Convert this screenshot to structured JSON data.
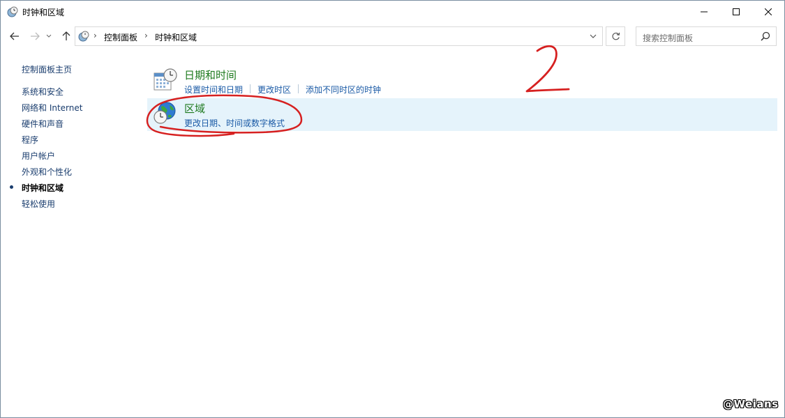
{
  "window": {
    "title": "时钟和区域"
  },
  "nav": {
    "back_icon": "arrow-left-icon",
    "forward_icon": "arrow-right-icon",
    "recent_icon": "chevron-down-icon",
    "up_icon": "arrow-up-icon"
  },
  "address": {
    "crumbs": [
      "控制面板",
      "时钟和区域"
    ]
  },
  "search": {
    "placeholder": "搜索控制面板"
  },
  "sidebar": {
    "home": "控制面板主页",
    "items": [
      {
        "label": "系统和安全",
        "current": false
      },
      {
        "label": "网络和 Internet",
        "current": false
      },
      {
        "label": "硬件和声音",
        "current": false
      },
      {
        "label": "程序",
        "current": false
      },
      {
        "label": "用户帐户",
        "current": false
      },
      {
        "label": "外观和个性化",
        "current": false
      },
      {
        "label": "时钟和区域",
        "current": true
      },
      {
        "label": "轻松使用",
        "current": false
      }
    ]
  },
  "categories": [
    {
      "title": "日期和时间",
      "icon": "calendar-clock-icon",
      "links": [
        "设置时间和日期",
        "更改时区",
        "添加不同时区的时钟"
      ]
    },
    {
      "title": "区域",
      "icon": "globe-clock-icon",
      "links": [
        "更改日期、时间或数字格式"
      ]
    }
  ],
  "annotation": {
    "step_number": "2",
    "color": "#d62020"
  },
  "watermark": "@Weians",
  "colors": {
    "link": "#1a5aa6",
    "category_title": "#1e7a1e",
    "highlight": "#e5f3fb"
  }
}
